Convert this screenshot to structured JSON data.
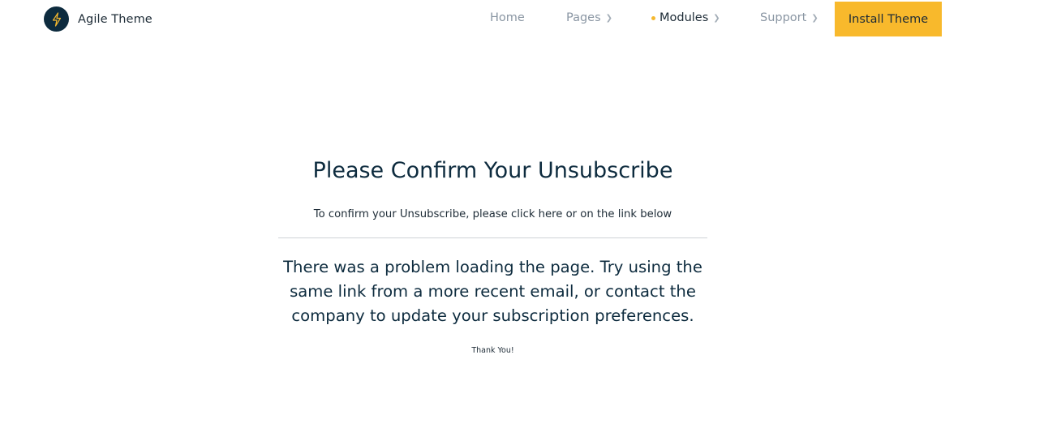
{
  "header": {
    "brand_name": "Agile Theme",
    "logo_icon": "lightning-bolt-icon",
    "nav": [
      {
        "label": "Home",
        "has_chevron": false,
        "active": false
      },
      {
        "label": "Pages",
        "has_chevron": true,
        "active": false
      },
      {
        "label": "Modules",
        "has_chevron": true,
        "active": true
      },
      {
        "label": "Support",
        "has_chevron": true,
        "active": false
      }
    ],
    "install_label": "Install Theme"
  },
  "main": {
    "title": "Please Confirm Your Unsubscribe",
    "subtitle_before": "To confirm your Unsubscribe, please click ",
    "subtitle_link": "here",
    "subtitle_after": " or on the link below",
    "message": "There was a problem loading the page. Try using the same link from a more recent email, or contact the company to update your subscription preferences.",
    "thanks": "Thank You!"
  },
  "colors": {
    "navy": "#0d2b3e",
    "accent": "#f8b92c",
    "muted": "#8a96a3",
    "divider": "#cfd3d7"
  }
}
